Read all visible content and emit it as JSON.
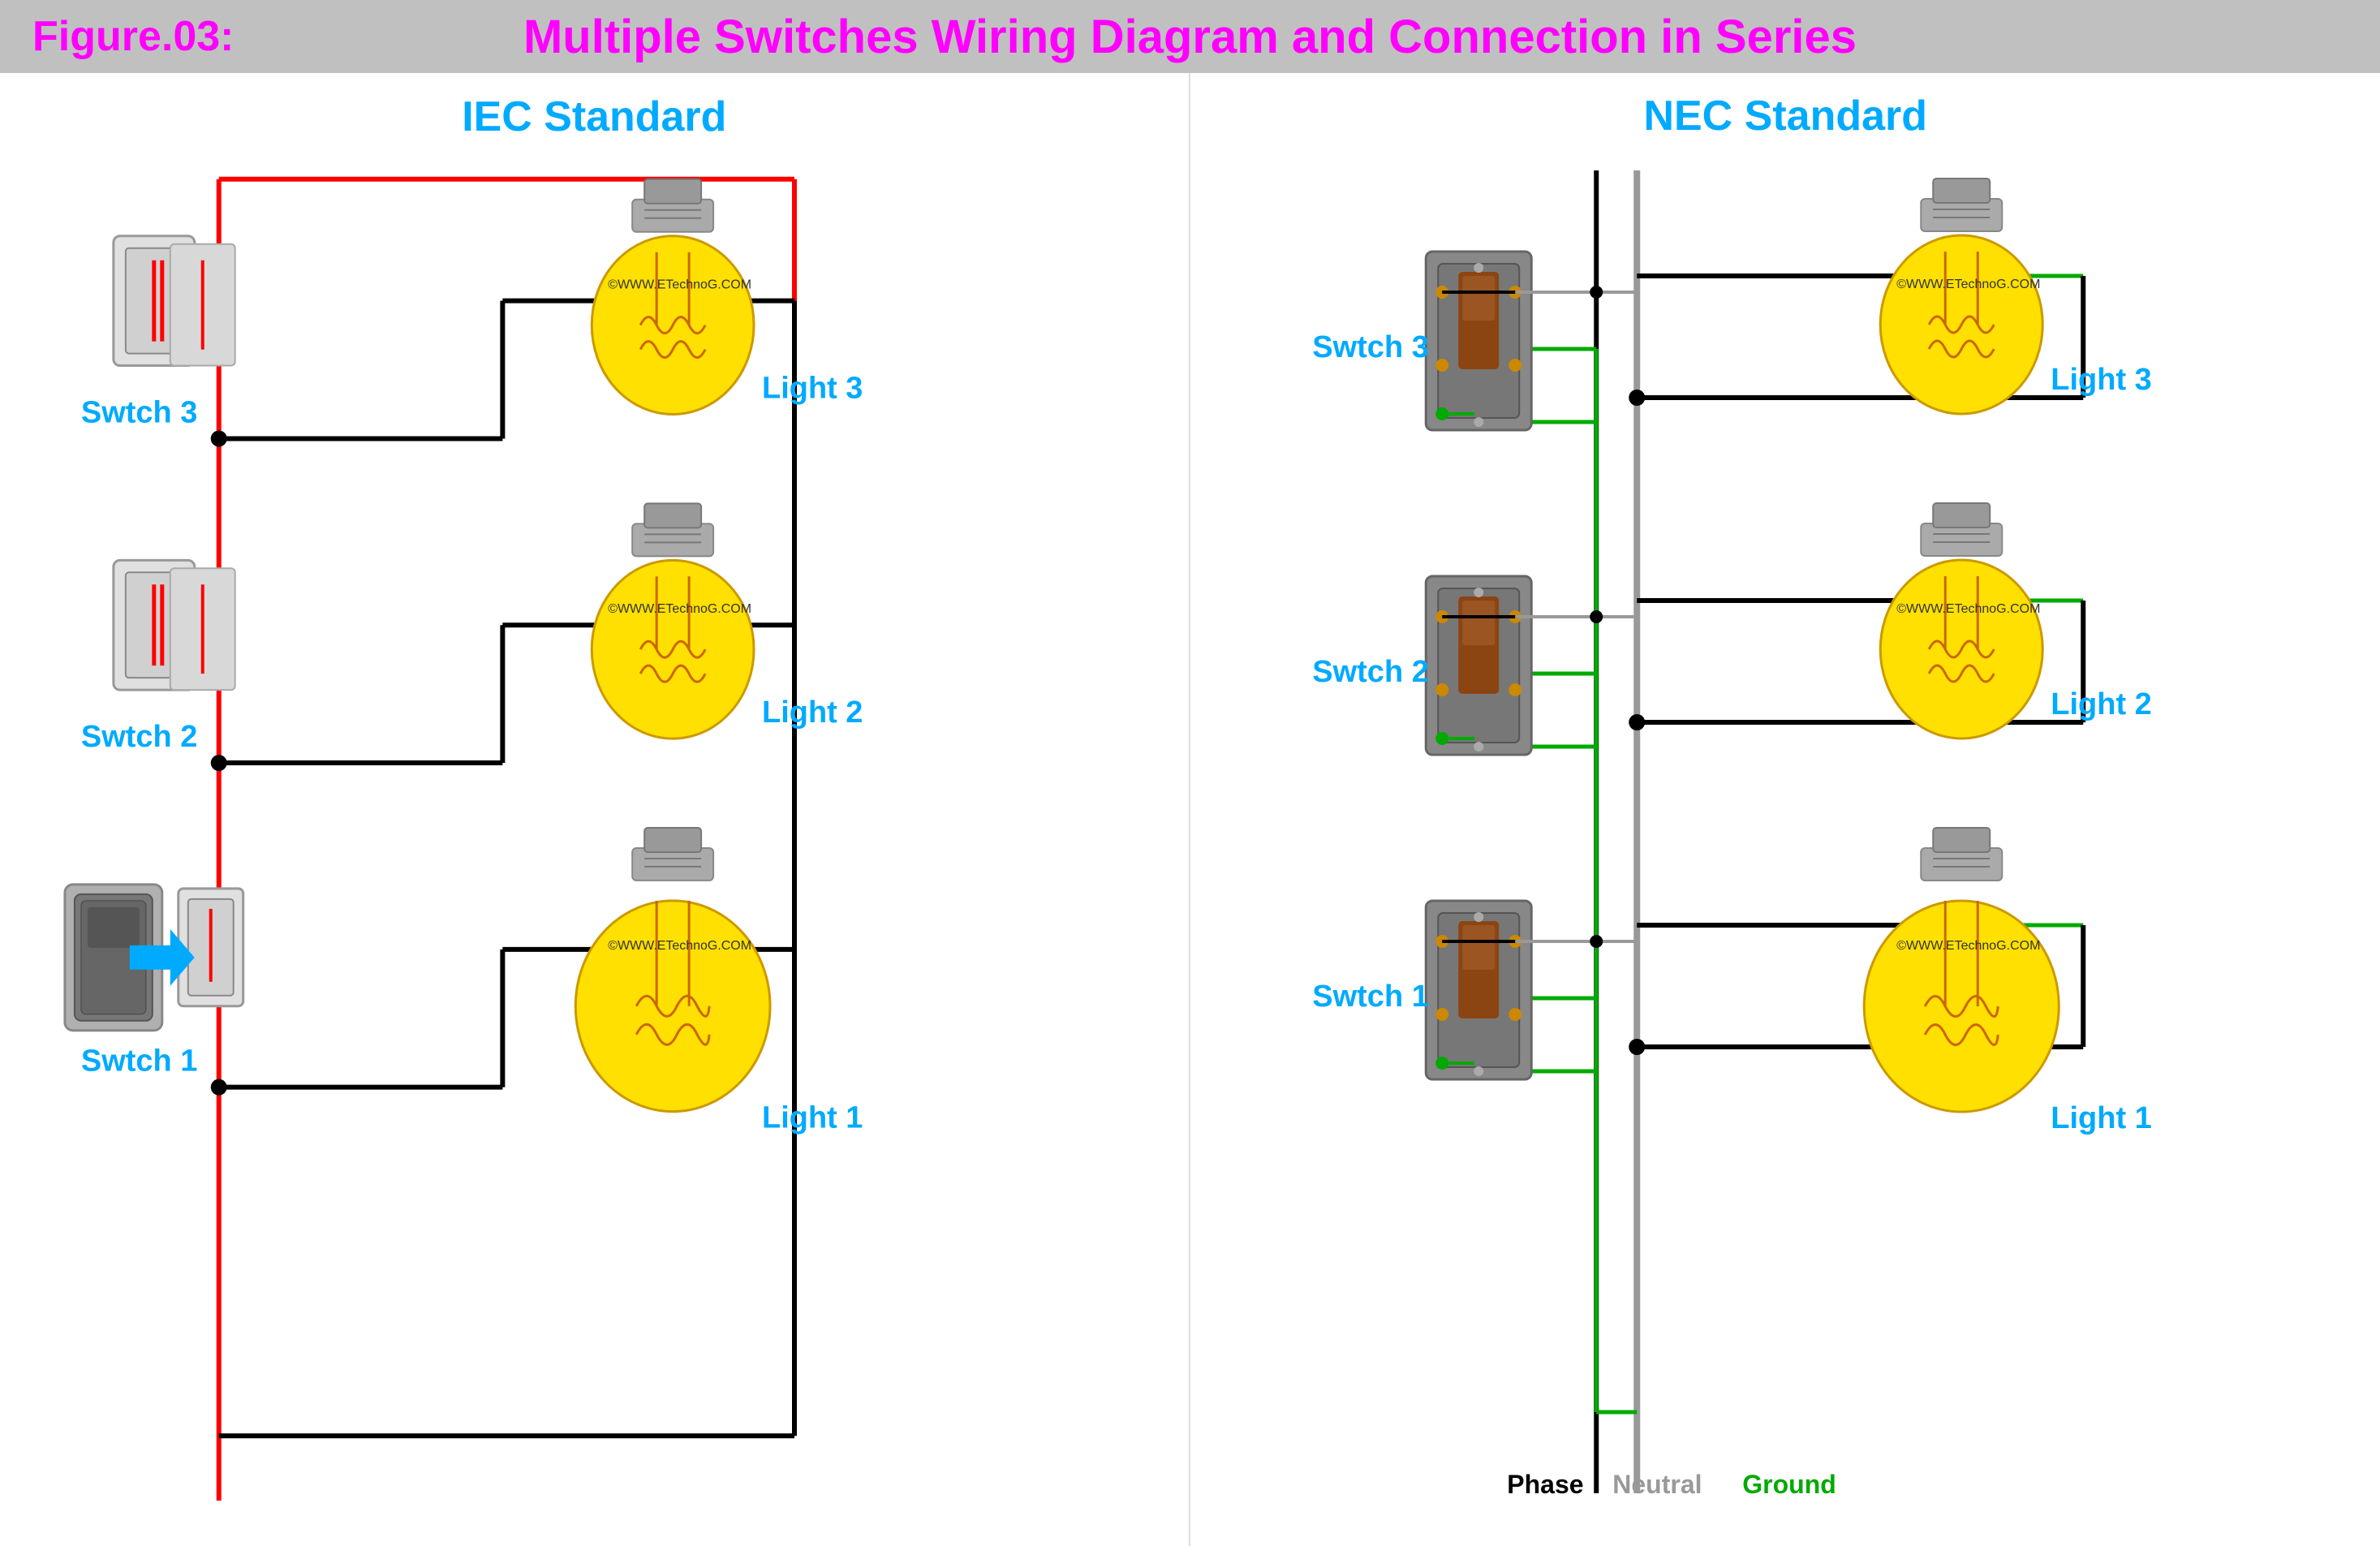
{
  "header": {
    "figure_label": "Figure.03:",
    "title": "Multiple Switches Wiring Diagram and Connection in Series"
  },
  "iec": {
    "title": "IEC Standard",
    "switches": [
      "Swtch 3",
      "Swtch 2",
      "Swtch 1"
    ],
    "lights": [
      "Light 3",
      "Light 2",
      "Light 1"
    ]
  },
  "nec": {
    "title": "NEC Standard",
    "switches": [
      "Swtch 3",
      "Swtch 2",
      "Swtch 1"
    ],
    "lights": [
      "Light 3",
      "Light 2",
      "Light 1"
    ]
  },
  "legend": {
    "phase": "Phase",
    "neutral": "Neutral",
    "ground": "Ground"
  },
  "watermark": "©WWW.ETechnoG.COM"
}
